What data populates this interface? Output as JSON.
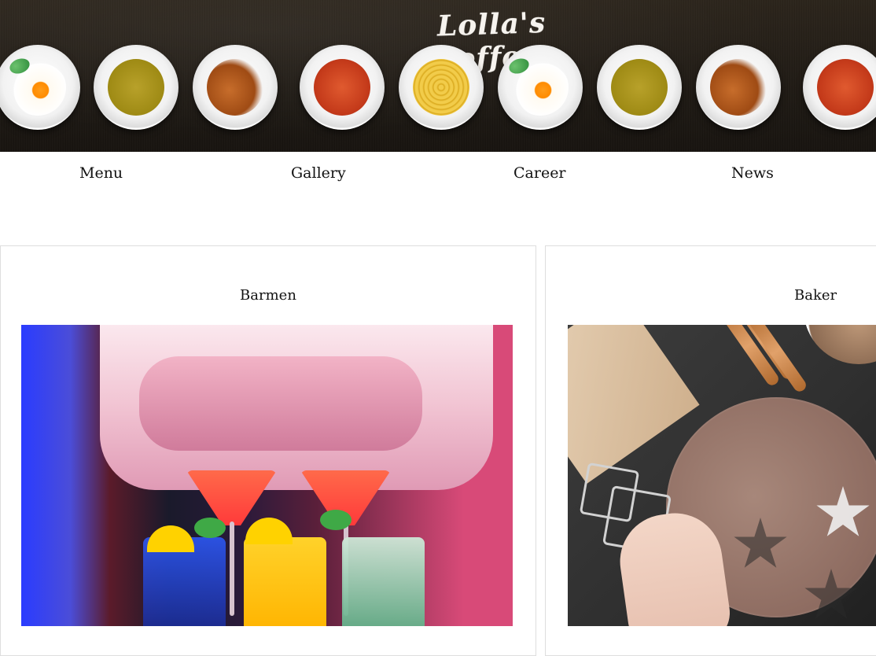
{
  "header": {
    "logo_text": "Lolla's coffee"
  },
  "nav": {
    "items": [
      {
        "label": "Menu"
      },
      {
        "label": "Gallery"
      },
      {
        "label": "Career"
      },
      {
        "label": "News"
      }
    ]
  },
  "cards": [
    {
      "title": "Barmen"
    },
    {
      "title": "Baker"
    }
  ]
}
